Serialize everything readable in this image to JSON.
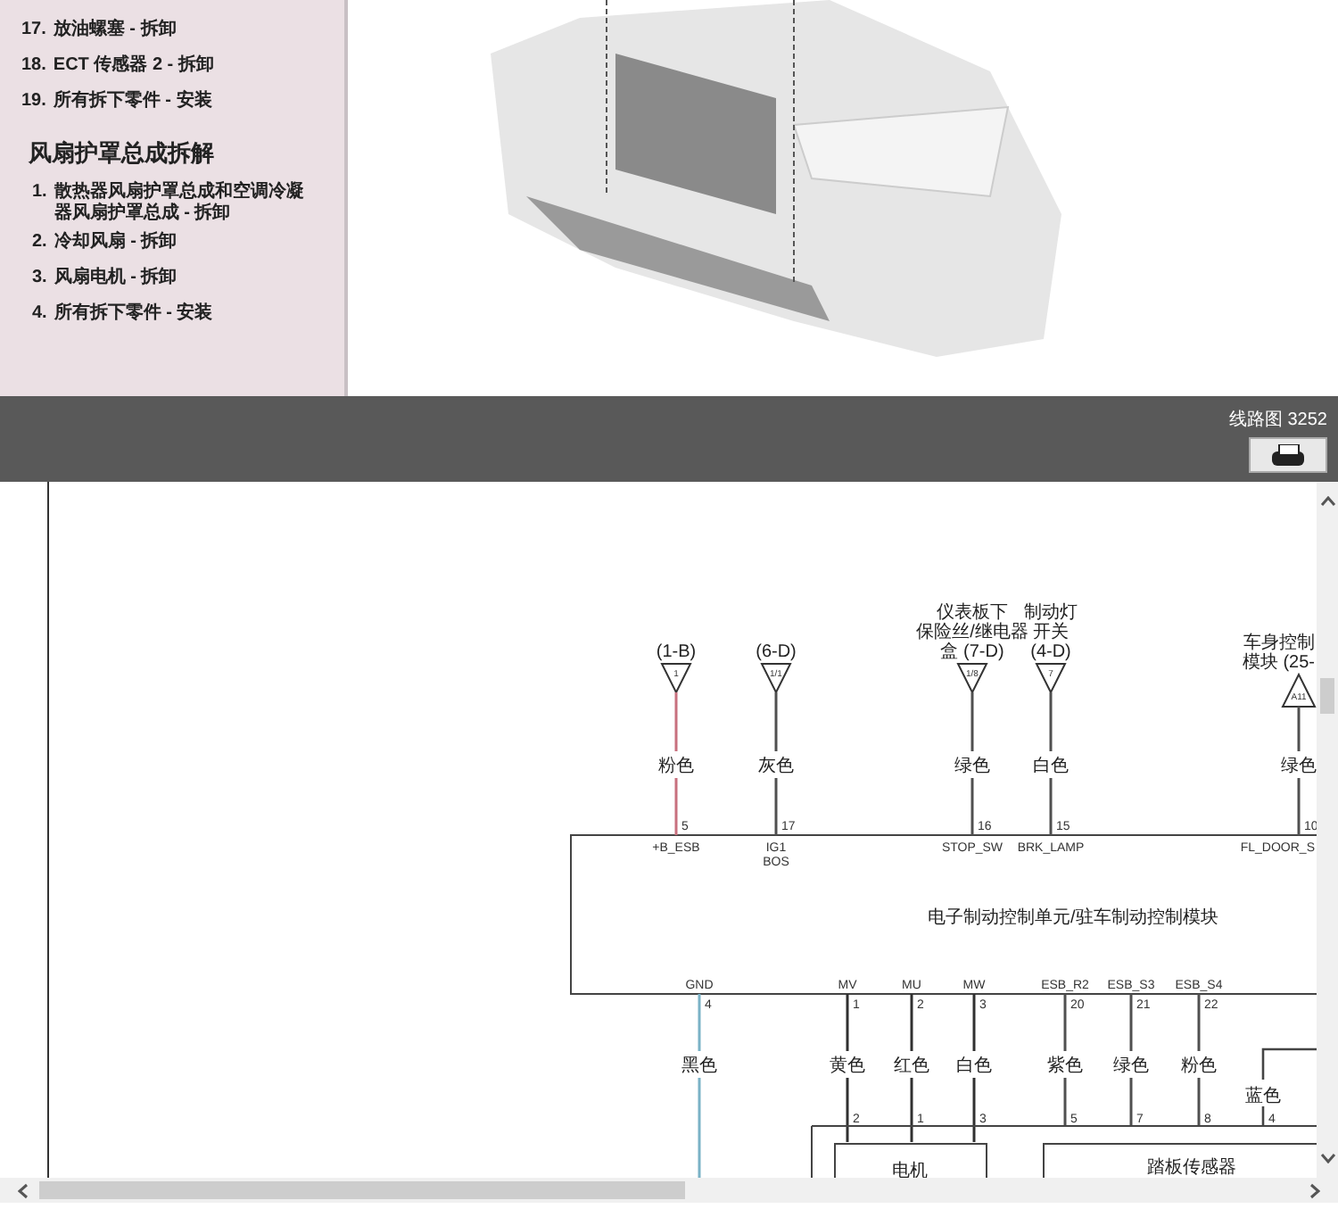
{
  "procedure_list": {
    "items_before": [
      {
        "number": "17.",
        "text": "放油螺塞 - 拆卸"
      },
      {
        "number": "18.",
        "text": "ECT 传感器 2 - 拆卸"
      },
      {
        "number": "19.",
        "text": "所有拆下零件 - 安装"
      }
    ],
    "section_title": "风扇护罩总成拆解",
    "items": [
      {
        "number": "1.",
        "text": "散热器风扇护罩总成和空调冷凝器风扇护罩总成 - 拆卸"
      },
      {
        "number": "2.",
        "text": "冷却风扇 - 拆卸"
      },
      {
        "number": "3.",
        "text": "风扇电机 - 拆卸"
      },
      {
        "number": "4.",
        "text": "所有拆下零件 - 安装"
      }
    ]
  },
  "diagram_bar": {
    "title": "线路图 3252"
  },
  "diagram": {
    "top_connectors": [
      {
        "location": [
          "(1-B)"
        ],
        "code": "1",
        "wire": "粉色",
        "pin": "5",
        "signal": "+B_ESB",
        "color": "#c8707e",
        "kind": "down"
      },
      {
        "location": [
          "(6-D)"
        ],
        "code": "1/1",
        "wire": "灰色",
        "pin": "17",
        "signal": "IG1 BOS",
        "color": "#505050",
        "kind": "down"
      },
      {
        "location": [
          "仪表板下",
          "保险丝/继电器",
          "盒 (7-D)"
        ],
        "code": "1/8",
        "wire": "绿色",
        "pin": "16",
        "signal": "STOP_SW",
        "color": "#505050",
        "kind": "down"
      },
      {
        "location": [
          "制动灯",
          "开关",
          "(4-D)"
        ],
        "code": "7",
        "wire": "白色",
        "pin": "15",
        "signal": "BRK_LAMP",
        "color": "#505050",
        "kind": "down"
      },
      {
        "location": [
          "车身控制",
          "模块 (25-"
        ],
        "code": "A11",
        "wire": "绿色",
        "pin": "10",
        "signal": "FL_DOOR_S",
        "color": "#505050",
        "kind": "up"
      }
    ],
    "module_label": "电子制动控制单元/驻车制动控制模块",
    "bottom_wires": [
      {
        "signal": "GND",
        "pin": "4",
        "wire": "黑色",
        "color": "#7ab2c6"
      },
      {
        "signal": "MV",
        "pin": "1",
        "wire": "黄色",
        "lower_pin": "2",
        "color": "#303030"
      },
      {
        "signal": "MU",
        "pin": "2",
        "wire": "红色",
        "lower_pin": "1",
        "color": "#303030"
      },
      {
        "signal": "MW",
        "pin": "3",
        "wire": "白色",
        "lower_pin": "3",
        "color": "#303030"
      },
      {
        "signal": "ESB_R2",
        "pin": "20",
        "wire": "紫色",
        "lower_pin": "5",
        "color": "#505050"
      },
      {
        "signal": "ESB_S3",
        "pin": "21",
        "wire": "绿色",
        "lower_pin": "7",
        "color": "#505050"
      },
      {
        "signal": "ESB_S4",
        "pin": "22",
        "wire": "粉色",
        "lower_pin": "8",
        "color": "#505050"
      }
    ],
    "side_wire": {
      "wire": "蓝色",
      "pin": "4"
    },
    "motor_label": "电机",
    "sensor_label": "踏板传感器"
  }
}
